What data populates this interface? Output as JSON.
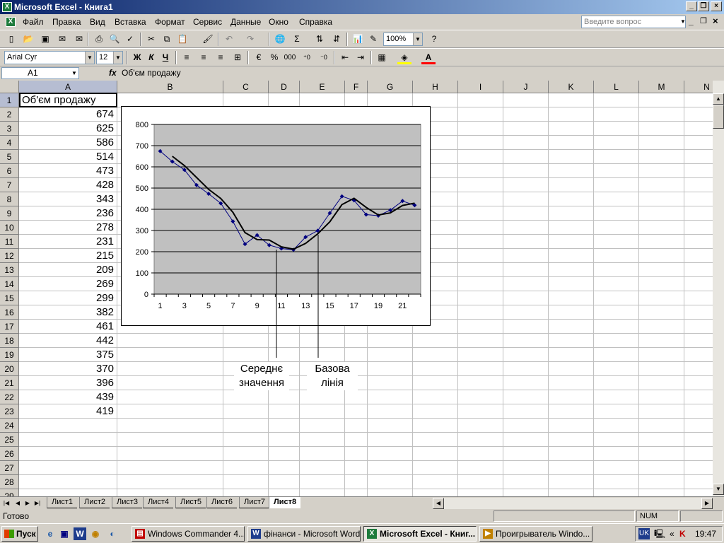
{
  "window": {
    "title": "Microsoft Excel - Книга1"
  },
  "menu": {
    "items": [
      "Файл",
      "Правка",
      "Вид",
      "Вставка",
      "Формат",
      "Сервис",
      "Данные",
      "Окно",
      "Справка"
    ],
    "ask_placeholder": "Введите вопрос"
  },
  "toolbar": {
    "zoom": "100%"
  },
  "format": {
    "font": "Arial Cyr",
    "size": "12",
    "bold": "Ж",
    "italic": "К",
    "underline": "Ч",
    "currency": "%",
    "thousands": "000"
  },
  "formula_bar": {
    "name_box": "A1",
    "fx": "fx",
    "content": "Об'єм продажу"
  },
  "columns": [
    "A",
    "B",
    "C",
    "D",
    "E",
    "F",
    "G",
    "H",
    "I",
    "J",
    "K",
    "L",
    "M",
    "N"
  ],
  "rows": [
    "1",
    "2",
    "3",
    "4",
    "5",
    "6",
    "7",
    "8",
    "9",
    "10",
    "11",
    "12",
    "13",
    "14",
    "15",
    "16",
    "17",
    "18",
    "19",
    "20",
    "21",
    "22",
    "23",
    "24",
    "25",
    "26",
    "27",
    "28",
    "29"
  ],
  "cells": {
    "a1": "Об'єм продажу",
    "column_a_values": [
      "674",
      "625",
      "586",
      "514",
      "473",
      "428",
      "343",
      "236",
      "278",
      "231",
      "215",
      "209",
      "269",
      "299",
      "382",
      "461",
      "442",
      "375",
      "370",
      "396",
      "439",
      "419"
    ]
  },
  "chart_data": {
    "type": "line",
    "x": [
      1,
      2,
      3,
      4,
      5,
      6,
      7,
      8,
      9,
      10,
      11,
      12,
      13,
      14,
      15,
      16,
      17,
      18,
      19,
      20,
      21,
      22
    ],
    "x_tick_labels": [
      "1",
      "3",
      "5",
      "7",
      "9",
      "11",
      "13",
      "15",
      "17",
      "19",
      "21"
    ],
    "y_tick_labels": [
      "0",
      "100",
      "200",
      "300",
      "400",
      "500",
      "600",
      "700",
      "800"
    ],
    "ylim": [
      0,
      800
    ],
    "grid": true,
    "series": [
      {
        "name": "",
        "values": [
          674,
          625,
          586,
          514,
          473,
          428,
          343,
          236,
          278,
          231,
          215,
          209,
          269,
          299,
          382,
          461,
          442,
          375,
          370,
          396,
          439,
          419
        ],
        "color": "#000080",
        "markers": true
      },
      {
        "name": "",
        "values": [
          null,
          650,
          606,
          550,
          494,
          451,
          386,
          290,
          257,
          255,
          223,
          212,
          239,
          284,
          341,
          422,
          452,
          409,
          373,
          383,
          418,
          429
        ],
        "color": "#000000",
        "markers": false
      }
    ],
    "plot_background": "#c0c0c0"
  },
  "annotations": {
    "average": "Середнє значення",
    "baseline": "Базова лінія"
  },
  "sheets": {
    "tabs": [
      "Лист1",
      "Лист2",
      "Лист3",
      "Лист4",
      "Лист5",
      "Лист6",
      "Лист7",
      "Лист8"
    ],
    "active": "Лист8"
  },
  "status": {
    "text": "Готово",
    "num": "NUM"
  },
  "taskbar": {
    "start": "Пуск",
    "buttons": [
      "Windows Commander 4....",
      "фінанси - Microsoft Word",
      "Microsoft Excel - Книг...",
      "Проигрыватель Windo..."
    ],
    "lang": "UK",
    "time": "19:47"
  }
}
